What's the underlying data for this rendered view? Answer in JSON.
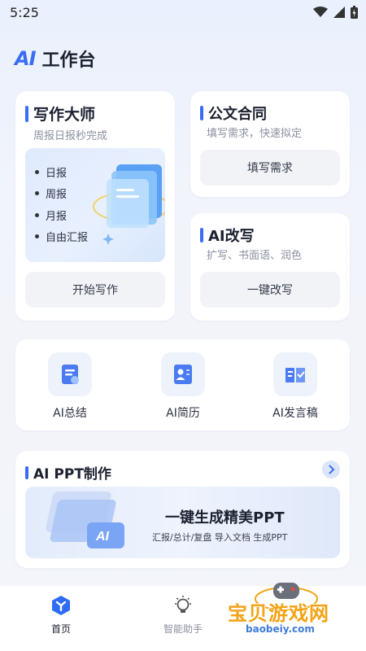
{
  "status": {
    "time": "5:25"
  },
  "header": {
    "logo": "AI",
    "title": "工作台"
  },
  "writer": {
    "title": "写作大师",
    "subtitle": "周报日报秒完成",
    "items": [
      "日报",
      "周报",
      "月报",
      "自由汇报"
    ],
    "button": "开始写作"
  },
  "docs": {
    "title": "公文合同",
    "subtitle": "填写需求，快速拟定",
    "button": "填写需求"
  },
  "rewrite": {
    "title": "AI改写",
    "subtitle": "扩写、书面语、润色",
    "button": "一键改写"
  },
  "tools": [
    {
      "label": "AI总结",
      "icon": "summary-icon"
    },
    {
      "label": "AI简历",
      "icon": "resume-icon"
    },
    {
      "label": "AI发言稿",
      "icon": "speech-icon"
    }
  ],
  "ppt": {
    "title": "AI PPT制作",
    "headline": "一键生成精美PPT",
    "tags": "汇报/总计/复盘  导入文档  生成PPT",
    "badge": "AI"
  },
  "nav": [
    {
      "label": "首页",
      "icon": "home-icon",
      "active": true
    },
    {
      "label": "智能助手",
      "icon": "lightbulb-icon",
      "active": false
    }
  ],
  "watermark": {
    "text": "宝贝游戏网",
    "url": "baobeiy.com"
  },
  "colors": {
    "accent": "#3b6cf6",
    "watermark": "#f2a316"
  }
}
